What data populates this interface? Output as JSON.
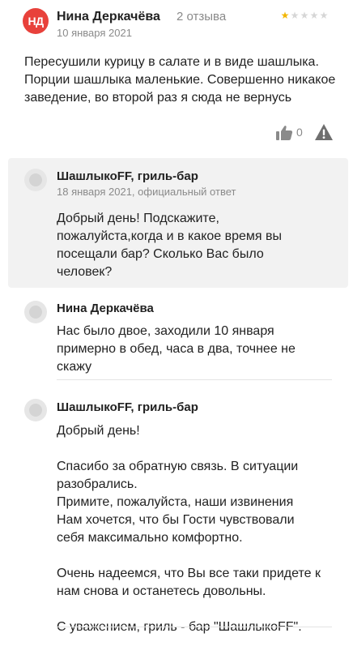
{
  "review": {
    "avatar_initials": "НД",
    "author": "Нина Деркачёва",
    "reviews_count": "2 отзыва",
    "rating": 1,
    "rating_max": 5,
    "date": "10 января 2021",
    "text": "Пересушили курицу в салате и в виде шашлыка. Порции шашлыка маленькие. Совершенно никакое заведение, во второй раз я сюда не вернусь",
    "likes": "0"
  },
  "official_reply": {
    "author": "ШашлыкоFF, гриль-бар",
    "meta": "18 января 2021, официальный ответ",
    "text": "Добрый день! Подскажите, пожалуйста,когда и в какое время вы посещали бар? Сколько Вас было человек?"
  },
  "comment_1": {
    "author": "Нина Деркачёва",
    "text": "Нас было двое, заходили 10 января примерно в обед, часа в два, точнее не скажу"
  },
  "comment_2": {
    "author": "ШашлыкоFF, гриль-бар",
    "text": "Добрый день!\n\nСпасибо за обратную связь. В ситуации разобрались.\nПримите, пожалуйста, наши извинения\nНам хочется, что бы Гости чувствовали себя максимально комфортно.\n\nОчень надеемся, что Вы все таки придете к нам снова и останетесь довольны.\n\nС уважением, гриль - бар \"ШашлыкоFF\"."
  },
  "colors": {
    "avatar_bg": "#e8413b",
    "star_active": "#f2b600",
    "star_inactive": "#d6d6d6",
    "reply_bg": "#f2f2f2"
  },
  "icons": [
    "thumbs-up-icon",
    "warning-icon",
    "user-placeholder-icon"
  ]
}
